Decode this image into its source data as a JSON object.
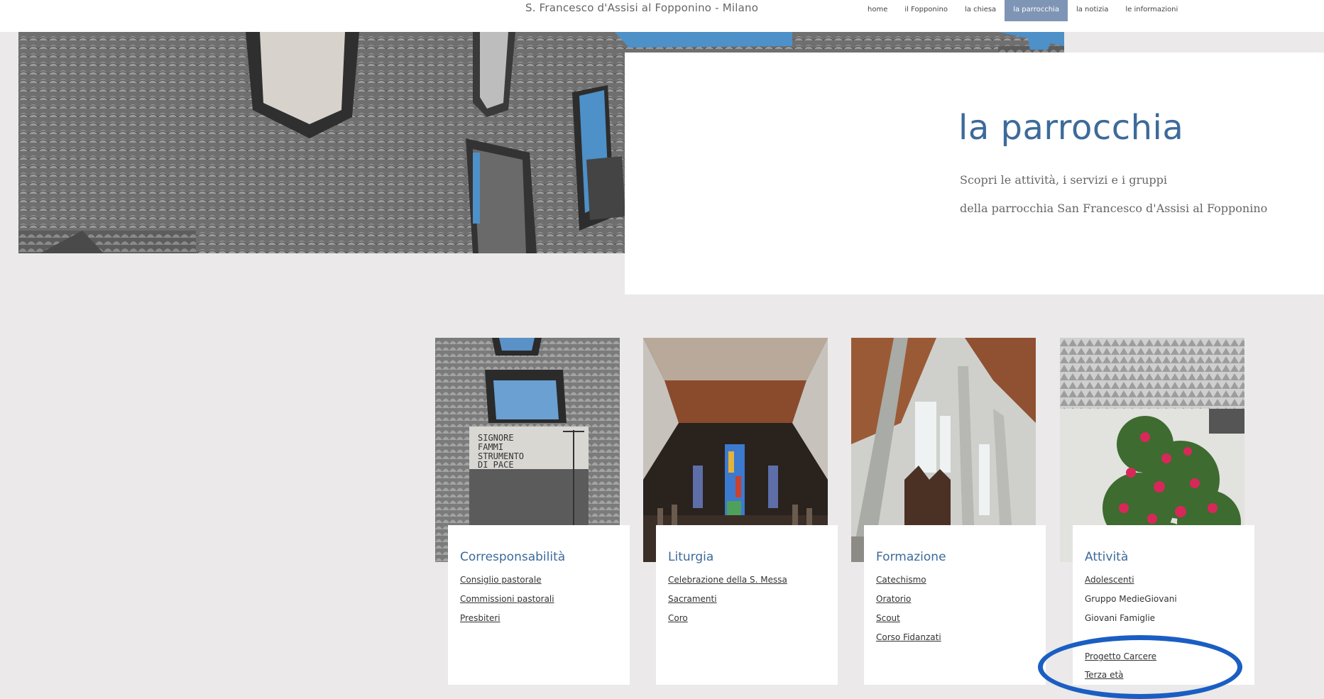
{
  "header": {
    "site_title": "S. Francesco d'Assisi al Fopponino - Milano",
    "nav": [
      {
        "label": "home",
        "active": false
      },
      {
        "label": "il Fopponino",
        "active": false
      },
      {
        "label": "la chiesa",
        "active": false
      },
      {
        "label": "la parrocchia",
        "active": true
      },
      {
        "label": "la notizia",
        "active": false
      },
      {
        "label": "le informazioni",
        "active": false
      }
    ]
  },
  "hero": {
    "title": "la parrocchia",
    "subtitle_line1": "Scopri le attività, i servizi e i gruppi",
    "subtitle_line2": "della parrocchia San Francesco d'Assisi al Fopponino"
  },
  "cards": [
    {
      "title": "Corresponsabilità",
      "links": [
        "Consiglio pastorale",
        "Commissioni pastorali",
        "Presbiteri"
      ],
      "image_text": "SIGNORE FAMMI STRUMENTO DI PACE"
    },
    {
      "title": "Liturgia",
      "links": [
        "Celebrazione della S. Messa",
        "Sacramenti",
        "Coro"
      ]
    },
    {
      "title": "Formazione",
      "links": [
        "Catechismo",
        "Oratorio",
        "Scout",
        "Corso Fidanzati"
      ]
    },
    {
      "title": "Attività",
      "links": [
        "Adolescenti",
        "Gruppo MedieGiovani",
        "Giovani Famiglie",
        "Progetto Carcere",
        "Terza età"
      ]
    }
  ],
  "colors": {
    "accent": "#3d6a9a",
    "nav_active": "#7f95b5",
    "background": "#ebe9e9",
    "annotation": "#1a5ec3"
  }
}
